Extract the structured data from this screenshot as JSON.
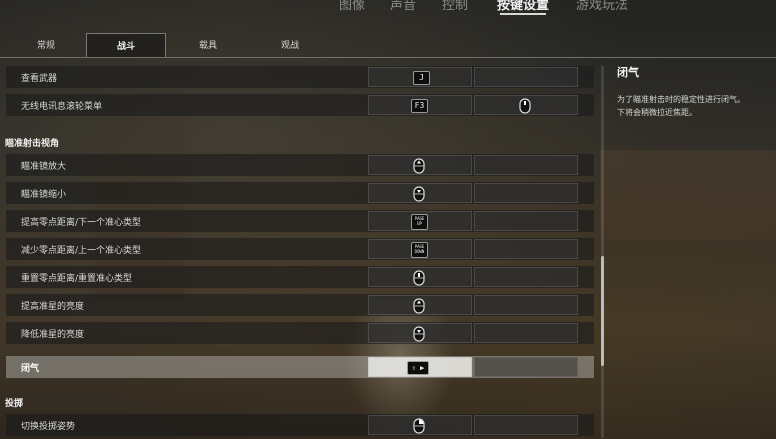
{
  "top_menu": {
    "items": [
      "图像",
      "声音",
      "控制",
      "按键设置",
      "游戏玩法"
    ],
    "active_index": 3
  },
  "subtabs": {
    "items": [
      "常规",
      "战斗",
      "载具",
      "观战"
    ],
    "active_index": 1
  },
  "rows_top": [
    {
      "label": "查看武器",
      "key": "J"
    },
    {
      "label": "无线电讯息滚轮菜单",
      "key": "F3",
      "alt": "mouse-middle"
    }
  ],
  "sections": {
    "aim": "瞄准射击视角",
    "throw": "投掷"
  },
  "rows_aim": [
    {
      "label": "瞄准镜放大",
      "binding": "mouse-scroll-up"
    },
    {
      "label": "瞄准镜缩小",
      "binding": "mouse-scroll-down"
    },
    {
      "label": "提高零点距离/下一个准心类型",
      "key": "PAGE\nUP"
    },
    {
      "label": "减少零点距离/上一个准心类型",
      "key": "PAGE\nDOWN"
    },
    {
      "label": "重置零点距离/重置准心类型",
      "binding": "mouse-middle"
    },
    {
      "label": "提高准星的亮度",
      "binding": "mouse-scroll-up"
    },
    {
      "label": "降低准星的亮度",
      "binding": "mouse-scroll-down"
    },
    {
      "label": "闭气",
      "key": "⇧ ▶",
      "selected": true
    }
  ],
  "rows_throw": [
    {
      "label": "切换投掷姿势",
      "binding": "mouse-right"
    }
  ],
  "description": {
    "title": "闭气",
    "text": "为了瞄准射击时的稳定性进行闭气。\n下将会稍微拉近焦距。"
  },
  "colors": {
    "selected_row": "#c8c8c3",
    "row_bg": "#1c1c1c",
    "accent_text": "#f0f0f0"
  }
}
